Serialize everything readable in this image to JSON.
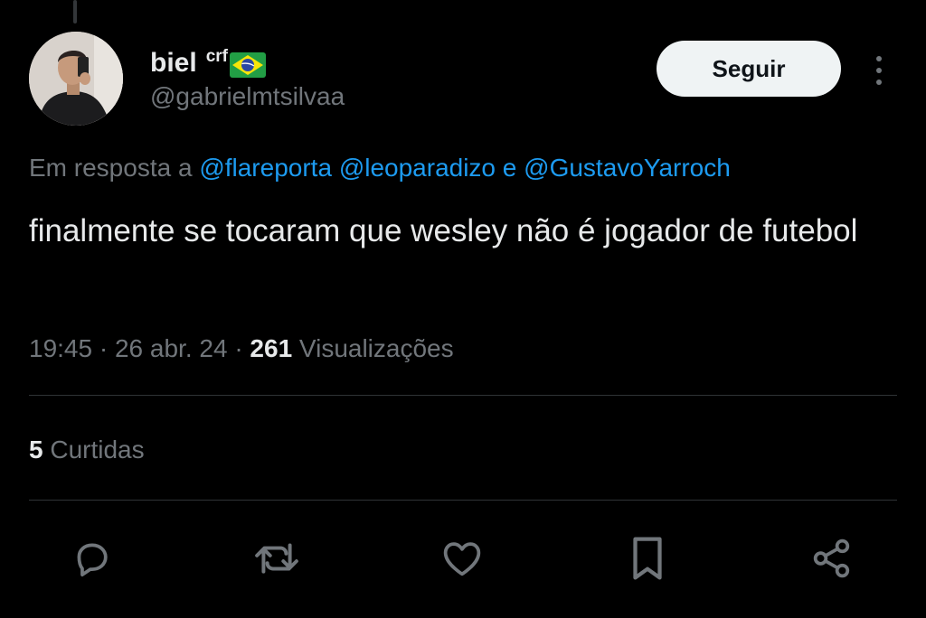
{
  "user": {
    "display_name": "biel",
    "name_suffix": "crf",
    "flag_icon": "brazil-flag-icon",
    "handle": "@gabrielmtsilvaa"
  },
  "follow_button": {
    "label": "Seguir"
  },
  "reply_context": {
    "prefix": "Em resposta a",
    "mention_1": "@flareporta",
    "mention_2": "@leoparadizo",
    "conjunction": "e",
    "mention_3": "@GustavoYarroch"
  },
  "tweet": {
    "text": "finalmente se tocaram que wesley não é jogador de futebol"
  },
  "meta": {
    "time": "19:45",
    "separator": "·",
    "date": "26 abr. 24",
    "views_count": "261",
    "views_label": "Visualizações"
  },
  "likes": {
    "count": "5",
    "label": "Curtidas"
  },
  "actions": [
    {
      "icon": "reply-icon"
    },
    {
      "icon": "retweet-icon"
    },
    {
      "icon": "like-icon"
    },
    {
      "icon": "bookmark-icon"
    },
    {
      "icon": "share-icon"
    }
  ],
  "colors": {
    "background": "#000000",
    "text_primary": "#e7e9ea",
    "text_secondary": "#71767b",
    "link": "#1d9bf0",
    "divider": "#2f3336",
    "button_bg": "#eff3f4"
  }
}
